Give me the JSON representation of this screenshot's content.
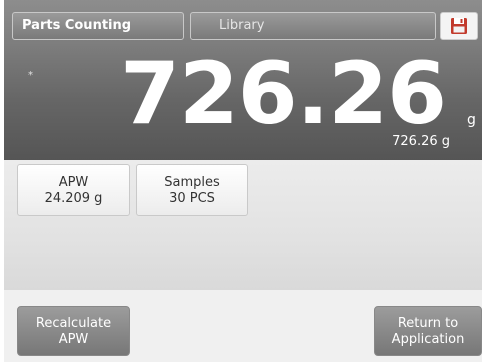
{
  "header": {
    "app_tab": "Parts Counting",
    "library_tab": "Library",
    "save_icon": "floppy-disk-icon"
  },
  "display": {
    "stable_marker": "*",
    "main_value": "726.26",
    "unit": "g",
    "secondary_value": "726.26 g"
  },
  "cards": {
    "apw": {
      "label": "APW",
      "value": "24.209 g"
    },
    "samples": {
      "label": "Samples",
      "value": "30 PCS"
    }
  },
  "buttons": {
    "recalculate_line1": "Recalculate",
    "recalculate_line2": "APW",
    "return_line1": "Return to",
    "return_line2": "Application"
  },
  "colors": {
    "header_gray": "#7d7d7d",
    "panel_gray": "#e2e2e2",
    "button_gray": "#8a8a8a"
  }
}
